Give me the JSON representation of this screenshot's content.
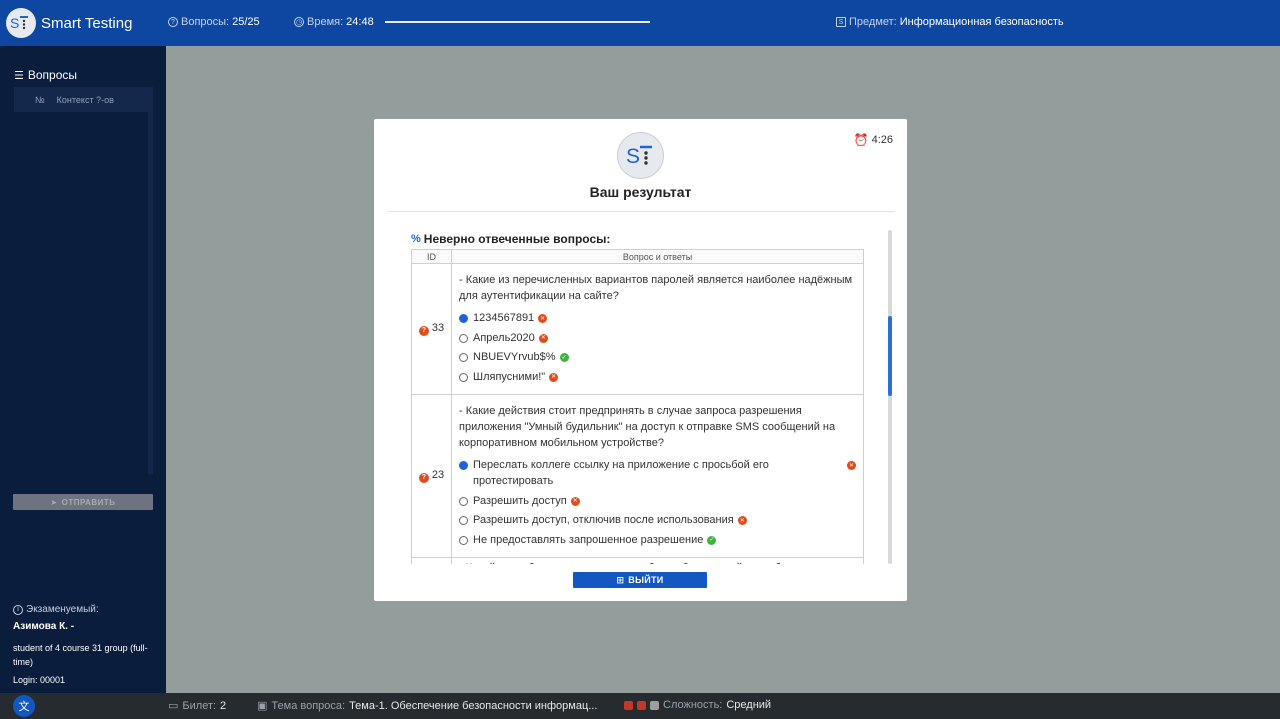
{
  "app": {
    "name": "Smart Testing"
  },
  "topbar": {
    "questions_label": "Вопросы:",
    "questions_value": "25/25",
    "time_label": "Время:",
    "time_value": "24:48",
    "subject_label": "Предмет:",
    "subject_value": "Информационная безопасность",
    "time_progress_fraction": 1.0
  },
  "sidebar": {
    "title": "Вопросы",
    "col_no": "№",
    "col_context": "Контекст ?-ов",
    "send_label": "ОТПРАВИТЬ",
    "examinee_label": "Экзаменуемый:",
    "examinee_name": "Азимова К. -",
    "examinee_group": "student of 4 course 31 group (full-time)",
    "login": "Login: 00001"
  },
  "bottombar": {
    "lang_icon": "translate-icon",
    "ticket_label": "Билет:",
    "ticket_value": "2",
    "topic_label": "Тема вопроса:",
    "topic_value": "Тема-1. Обеспечение безопасности информац...",
    "difficulty_label": "Сложность:",
    "difficulty_value": "Средний"
  },
  "modal": {
    "timer": "4:26",
    "title": "Ваш результат",
    "section_title": "Неверно отвеченные вопросы:",
    "col_id": "ID",
    "col_qa": "Вопрос и ответы",
    "exit_label": "ВЫЙТИ",
    "questions": [
      {
        "id": "33",
        "text": "- Какие из перечисленных вариантов паролей является наиболее надёжным для аутентификации на сайте?",
        "answers": [
          {
            "text": "1234567891",
            "selected": true,
            "correct": false
          },
          {
            "text": "Апрель2020",
            "selected": false,
            "correct": false
          },
          {
            "text": "NBUEVYrvub$%",
            "selected": false,
            "correct": true
          },
          {
            "text": "Шляпусними!\"",
            "selected": false,
            "correct": false
          }
        ]
      },
      {
        "id": "23",
        "text": "- Какие действия стоит предпринять в случае запроса разрешения приложения \"Умный будильник\" на доступ к отправке SMS сообщений на корпоративном мобильном устройстве?",
        "answers": [
          {
            "text": "Переслать коллеге ссылку на приложение с просьбой его протестировать",
            "selected": true,
            "correct": false,
            "wide": true
          },
          {
            "text": "Разрешить доступ",
            "selected": false,
            "correct": false
          },
          {
            "text": "Разрешить доступ, отключив после использования",
            "selected": false,
            "correct": false
          },
          {
            "text": "Не предоставлять запрошенное разрешение",
            "selected": false,
            "correct": true
          }
        ]
      }
    ],
    "partial_text": "- Какой способ хранения данных наиболее безопасный на мобильном"
  },
  "colors": {
    "topbar": "#0e47a1",
    "sidebar": "#0a1d3d",
    "accent": "#1557c0",
    "wrong": "#e04b1c",
    "right": "#3fb33f",
    "difficulty_squares": [
      "#c0392b",
      "#c0392b",
      "#9e9e9e"
    ]
  }
}
